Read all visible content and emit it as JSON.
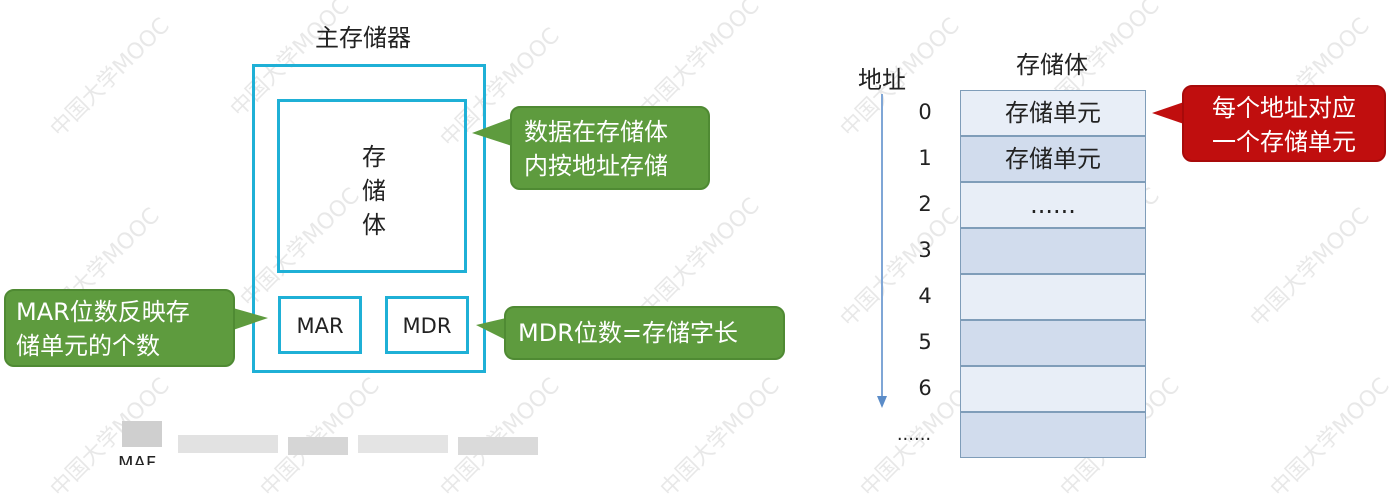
{
  "left_diagram": {
    "title": "主存储器",
    "storage_body_chars": [
      "存",
      "储",
      "体"
    ],
    "mar": "MAR",
    "mdr": "MDR",
    "callout_data": [
      "数据在存储体",
      "内按地址存储"
    ],
    "callout_mar": [
      "MAR位数反映存",
      "储单元的个数"
    ],
    "callout_mdr": "MDR位数=存储字长"
  },
  "right_diagram": {
    "address_label": "地址",
    "storage_body_label": "存储体",
    "addresses": [
      "0",
      "1",
      "2",
      "3",
      "4",
      "5",
      "6",
      "......"
    ],
    "cells": [
      "存储单元",
      "存储单元",
      "......",
      "",
      "",
      "",
      "",
      ""
    ],
    "callout_addr": [
      "每个地址对应",
      "一个存储单元"
    ]
  },
  "watermark": "中国大学MOOC",
  "footer_fragment": "MAF",
  "colors": {
    "box_border": "#1fb0d6",
    "callout_green": "#5e9b3e",
    "callout_red": "#c00e0e",
    "cell_light": "#e8eef7",
    "cell_dark": "#d1dced",
    "arrow": "#7fa6d6"
  }
}
